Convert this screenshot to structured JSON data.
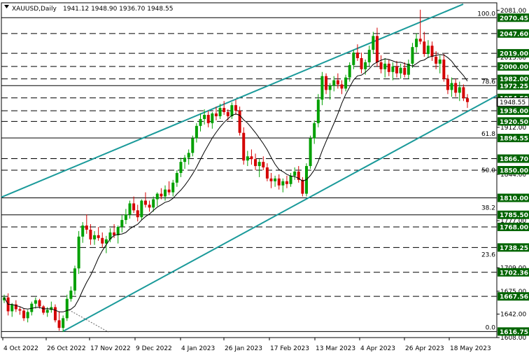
{
  "header": {
    "symbol": "XAUUSD,Daily",
    "ohlc": "1941.12 1948.90 1936.70 1948.55"
  },
  "colors": {
    "bull": "#00a000",
    "bear": "#d40000",
    "channel": "#1a9a9a",
    "level_label_bg": "#006400",
    "current_price_bg": "#ffffff"
  },
  "price_axis_ticks": [
    "2081.00",
    "2013.00",
    "1912.00",
    "1844.00",
    "1777.00",
    "1709.00",
    "1675.00",
    "1642.00",
    "1608.00"
  ],
  "horizontal_levels": [
    {
      "label": "2070.45",
      "value": 2070.45,
      "style": "solid"
    },
    {
      "label": "2047.60",
      "value": 2047.6,
      "style": "dashed"
    },
    {
      "label": "2019.00",
      "value": 2019.0,
      "style": "dashed"
    },
    {
      "label": "2000.00",
      "value": 2000.0,
      "style": "dashed"
    },
    {
      "label": "1982.00",
      "value": 1982.0,
      "style": "dashed"
    },
    {
      "label": "1972.25",
      "value": 1972.25,
      "style": "solid"
    },
    {
      "label": "1954.50",
      "value": 1954.5,
      "style": "dashed"
    },
    {
      "label": "1936.00",
      "value": 1936.0,
      "style": "dashed"
    },
    {
      "label": "1920.50",
      "value": 1920.5,
      "style": "dashed"
    },
    {
      "label": "1896.55",
      "value": 1896.55,
      "style": "solid"
    },
    {
      "label": "1866.70",
      "value": 1866.7,
      "style": "dashed"
    },
    {
      "label": "1850.00",
      "value": 1850.0,
      "style": "dashed"
    },
    {
      "label": "1810.00",
      "value": 1810.0,
      "style": "solid"
    },
    {
      "label": "1785.50",
      "value": 1785.5,
      "style": "solid"
    },
    {
      "label": "1768.00",
      "value": 1768.0,
      "style": "dashed"
    },
    {
      "label": "1738.25",
      "value": 1738.25,
      "style": "dashed"
    },
    {
      "label": "1702.36",
      "value": 1702.36,
      "style": "dashed"
    },
    {
      "label": "1667.56",
      "value": 1667.56,
      "style": "dashed"
    },
    {
      "label": "1616.75",
      "value": 1616.75,
      "style": "solid"
    }
  ],
  "current_price": {
    "label": "1948.55",
    "value": 1948.55
  },
  "fib_levels": [
    {
      "label": "100.0",
      "value": 2070.45
    },
    {
      "label": "78.6",
      "value": 1972.25
    },
    {
      "label": "61.8",
      "value": 1896.55
    },
    {
      "label": "50.0",
      "value": 1844.0
    },
    {
      "label": "38.2",
      "value": 1790.0
    },
    {
      "label": "23.6",
      "value": 1722.0
    },
    {
      "label": "0.0",
      "value": 1616.75
    }
  ],
  "date_labels": [
    "4 Oct 2022",
    "26 Oct 2022",
    "17 Nov 2022",
    "9 Dec 2022",
    "4 Jan 2023",
    "26 Jan 2023",
    "17 Feb 2023",
    "13 Mar 2023",
    "4 Apr 2023",
    "26 Apr 2023",
    "18 May 2023"
  ],
  "chart_data": {
    "type": "line",
    "x_axis": "date",
    "y_axis": "price",
    "ylim": [
      1608,
      2092
    ],
    "candles": [
      [
        1662,
        1670,
        1658,
        1666
      ],
      [
        1666,
        1672,
        1640,
        1646
      ],
      [
        1646,
        1658,
        1638,
        1656
      ],
      [
        1656,
        1662,
        1645,
        1649
      ],
      [
        1649,
        1653,
        1641,
        1647
      ],
      [
        1647,
        1650,
        1632,
        1636
      ],
      [
        1636,
        1648,
        1630,
        1645
      ],
      [
        1645,
        1660,
        1640,
        1657
      ],
      [
        1657,
        1666,
        1650,
        1662
      ],
      [
        1662,
        1664,
        1650,
        1653
      ],
      [
        1653,
        1655,
        1641,
        1644
      ],
      [
        1644,
        1652,
        1638,
        1648
      ],
      [
        1648,
        1660,
        1644,
        1652
      ],
      [
        1652,
        1656,
        1630,
        1633
      ],
      [
        1633,
        1646,
        1618,
        1622
      ],
      [
        1622,
        1640,
        1616,
        1636
      ],
      [
        1636,
        1670,
        1632,
        1664
      ],
      [
        1664,
        1682,
        1660,
        1676
      ],
      [
        1676,
        1712,
        1670,
        1708
      ],
      [
        1708,
        1762,
        1700,
        1754
      ],
      [
        1754,
        1775,
        1745,
        1770
      ],
      [
        1770,
        1786,
        1758,
        1764
      ],
      [
        1764,
        1772,
        1742,
        1750
      ],
      [
        1750,
        1762,
        1742,
        1756
      ],
      [
        1756,
        1768,
        1748,
        1752
      ],
      [
        1752,
        1760,
        1738,
        1744
      ],
      [
        1744,
        1755,
        1730,
        1750
      ],
      [
        1750,
        1766,
        1746,
        1760
      ],
      [
        1760,
        1772,
        1752,
        1756
      ],
      [
        1756,
        1770,
        1744,
        1768
      ],
      [
        1768,
        1785,
        1760,
        1778
      ],
      [
        1778,
        1794,
        1772,
        1786
      ],
      [
        1786,
        1806,
        1780,
        1802
      ],
      [
        1802,
        1812,
        1788,
        1792
      ],
      [
        1792,
        1800,
        1776,
        1782
      ],
      [
        1782,
        1808,
        1778,
        1806
      ],
      [
        1806,
        1818,
        1796,
        1800
      ],
      [
        1800,
        1806,
        1790,
        1796
      ],
      [
        1796,
        1812,
        1790,
        1808
      ],
      [
        1808,
        1818,
        1798,
        1816
      ],
      [
        1816,
        1824,
        1808,
        1812
      ],
      [
        1812,
        1828,
        1806,
        1822
      ],
      [
        1822,
        1834,
        1814,
        1818
      ],
      [
        1818,
        1836,
        1812,
        1832
      ],
      [
        1832,
        1850,
        1826,
        1846
      ],
      [
        1846,
        1868,
        1840,
        1862
      ],
      [
        1862,
        1872,
        1852,
        1868
      ],
      [
        1868,
        1880,
        1858,
        1875
      ],
      [
        1875,
        1900,
        1870,
        1896
      ],
      [
        1896,
        1918,
        1890,
        1914
      ],
      [
        1914,
        1932,
        1906,
        1924
      ],
      [
        1924,
        1938,
        1916,
        1930
      ],
      [
        1930,
        1936,
        1912,
        1918
      ],
      [
        1918,
        1934,
        1910,
        1932
      ],
      [
        1932,
        1942,
        1922,
        1928
      ],
      [
        1928,
        1946,
        1924,
        1940
      ],
      [
        1940,
        1950,
        1930,
        1934
      ],
      [
        1934,
        1938,
        1922,
        1928
      ],
      [
        1928,
        1948,
        1924,
        1944
      ],
      [
        1944,
        1952,
        1930,
        1936
      ],
      [
        1936,
        1942,
        1900,
        1904
      ],
      [
        1904,
        1912,
        1858,
        1864
      ],
      [
        1864,
        1878,
        1856,
        1870
      ],
      [
        1870,
        1880,
        1858,
        1866
      ],
      [
        1866,
        1874,
        1850,
        1856
      ],
      [
        1856,
        1866,
        1840,
        1862
      ],
      [
        1862,
        1870,
        1850,
        1854
      ],
      [
        1854,
        1860,
        1834,
        1838
      ],
      [
        1838,
        1846,
        1824,
        1834
      ],
      [
        1834,
        1842,
        1826,
        1838
      ],
      [
        1838,
        1844,
        1822,
        1828
      ],
      [
        1828,
        1838,
        1818,
        1834
      ],
      [
        1834,
        1842,
        1824,
        1830
      ],
      [
        1830,
        1846,
        1826,
        1842
      ],
      [
        1842,
        1854,
        1836,
        1848
      ],
      [
        1848,
        1856,
        1832,
        1836
      ],
      [
        1836,
        1840,
        1812,
        1816
      ],
      [
        1816,
        1860,
        1812,
        1856
      ],
      [
        1856,
        1900,
        1852,
        1896
      ],
      [
        1896,
        1922,
        1888,
        1918
      ],
      [
        1918,
        1960,
        1912,
        1952
      ],
      [
        1952,
        1992,
        1944,
        1986
      ],
      [
        1986,
        1990,
        1960,
        1966
      ],
      [
        1966,
        1976,
        1952,
        1972
      ],
      [
        1972,
        1986,
        1964,
        1980
      ],
      [
        1980,
        1990,
        1968,
        1974
      ],
      [
        1974,
        1980,
        1960,
        1968
      ],
      [
        1968,
        1988,
        1964,
        1984
      ],
      [
        1984,
        2006,
        1978,
        2002
      ],
      [
        2002,
        2024,
        1996,
        2020
      ],
      [
        2020,
        2032,
        2008,
        2012
      ],
      [
        2012,
        2020,
        1990,
        1996
      ],
      [
        1996,
        2010,
        1988,
        2006
      ],
      [
        2006,
        2030,
        2000,
        2024
      ],
      [
        2024,
        2050,
        2018,
        2044
      ],
      [
        2044,
        2056,
        2000,
        2006
      ],
      [
        2006,
        2016,
        1990,
        1996
      ],
      [
        1996,
        2012,
        1984,
        2004
      ],
      [
        2004,
        2010,
        1986,
        1992
      ],
      [
        1992,
        2006,
        1980,
        2000
      ],
      [
        2000,
        2008,
        1984,
        1990
      ],
      [
        1990,
        2004,
        1982,
        1998
      ],
      [
        1998,
        2006,
        1984,
        1988
      ],
      [
        1988,
        2010,
        1982,
        2004
      ],
      [
        2004,
        2034,
        1998,
        2028
      ],
      [
        2028,
        2048,
        2020,
        2040
      ],
      [
        2040,
        2082,
        2032,
        2036
      ],
      [
        2036,
        2050,
        2014,
        2018
      ],
      [
        2018,
        2038,
        2012,
        2030
      ],
      [
        2030,
        2036,
        2008,
        2014
      ],
      [
        2014,
        2022,
        1996,
        2004
      ],
      [
        2004,
        2016,
        1990,
        2010
      ],
      [
        2010,
        2018,
        1978,
        1982
      ],
      [
        1982,
        1988,
        1960,
        1966
      ],
      [
        1966,
        1984,
        1956,
        1976
      ],
      [
        1976,
        1982,
        1956,
        1962
      ],
      [
        1962,
        1978,
        1950,
        1970
      ],
      [
        1970,
        1974,
        1950,
        1954
      ],
      [
        1954,
        1960,
        1940,
        1948.55
      ]
    ]
  }
}
